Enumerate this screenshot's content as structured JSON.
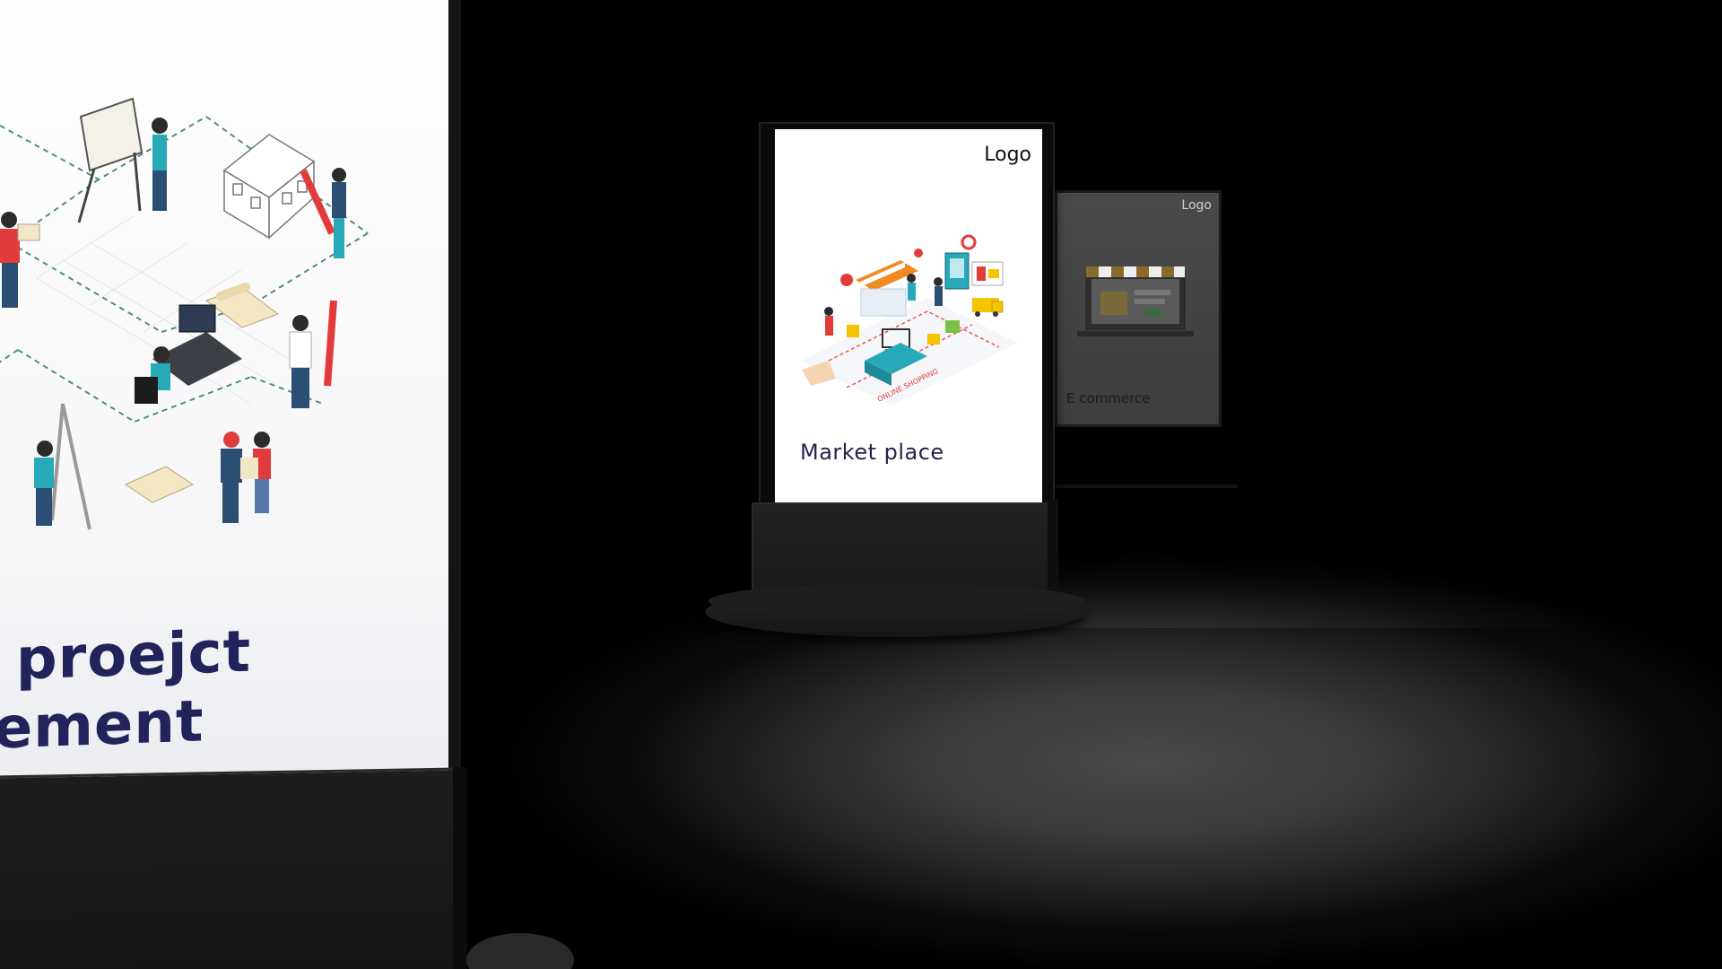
{
  "left_board": {
    "title_line1": "r proejct",
    "title_line2": "gement"
  },
  "kiosk": {
    "logo": "Logo",
    "title": "Market place",
    "illustration_caption": "ONLINE SHOPPING"
  },
  "far_board": {
    "logo": "Logo",
    "title": "E commerce"
  },
  "colors": {
    "title_navy": "#22235a",
    "accent_red": "#e23b3b",
    "accent_teal": "#27a9b8",
    "accent_yellow": "#f5c400",
    "accent_orange": "#f08a24"
  }
}
